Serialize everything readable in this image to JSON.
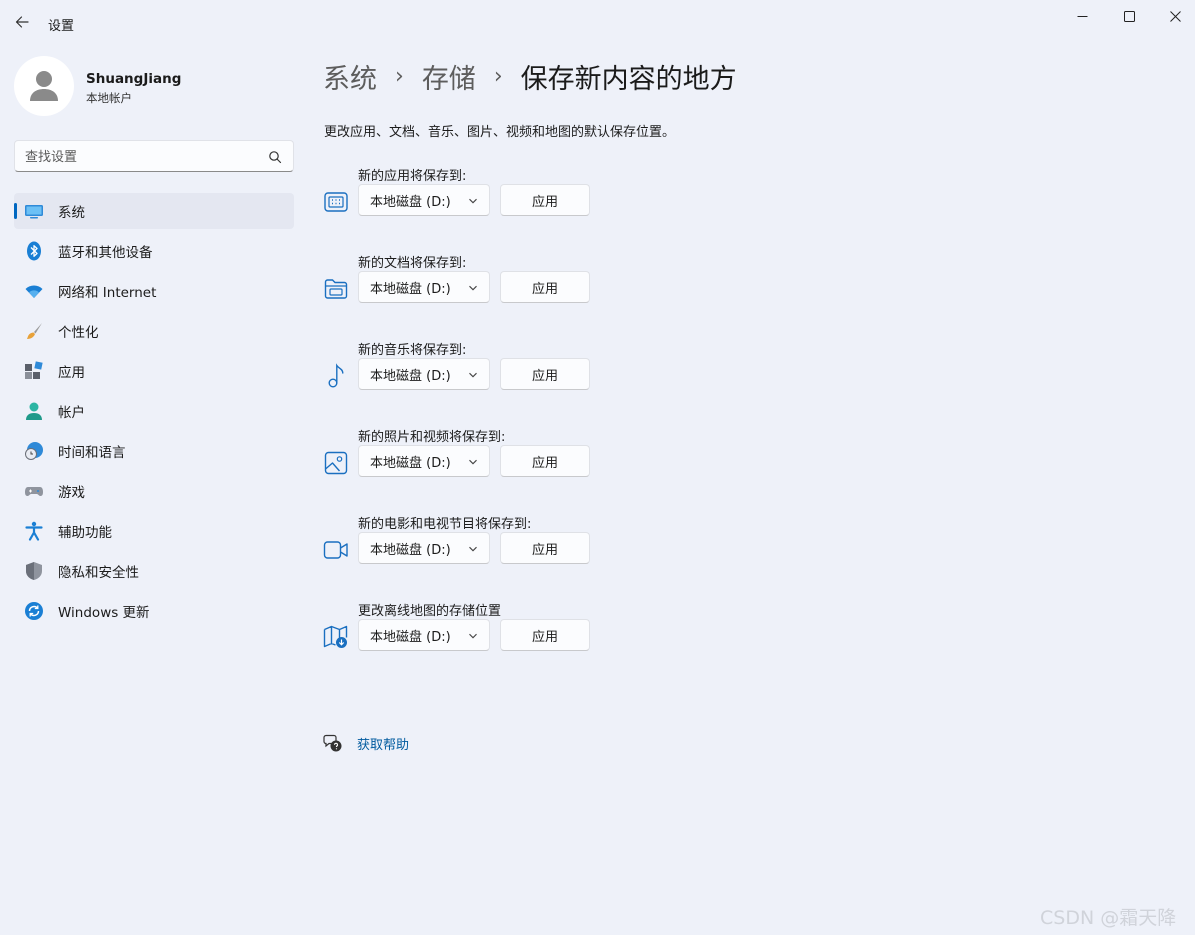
{
  "window": {
    "title": "设置",
    "back_icon": "back-arrow-icon",
    "controls": [
      "minimize-icon",
      "maximize-icon",
      "close-icon"
    ]
  },
  "profile": {
    "name": "ShuangJiang",
    "account_type": "本地帐户"
  },
  "search": {
    "placeholder": "查找设置"
  },
  "sidebar": {
    "active_index": 0,
    "items": [
      {
        "label": "系统",
        "icon": "system-display-icon"
      },
      {
        "label": "蓝牙和其他设备",
        "icon": "bluetooth-icon"
      },
      {
        "label": "网络和 Internet",
        "icon": "wifi-icon"
      },
      {
        "label": "个性化",
        "icon": "paintbrush-icon"
      },
      {
        "label": "应用",
        "icon": "apps-icon"
      },
      {
        "label": "帐户",
        "icon": "account-icon"
      },
      {
        "label": "时间和语言",
        "icon": "globe-clock-icon"
      },
      {
        "label": "游戏",
        "icon": "gamepad-icon"
      },
      {
        "label": "辅助功能",
        "icon": "accessibility-icon"
      },
      {
        "label": "隐私和安全性",
        "icon": "shield-icon"
      },
      {
        "label": "Windows 更新",
        "icon": "update-icon"
      }
    ]
  },
  "breadcrumb": {
    "items": [
      "系统",
      "存储",
      "保存新内容的地方"
    ],
    "separator": "›"
  },
  "main": {
    "description": "更改应用、文档、音乐、图片、视频和地图的默认保存位置。",
    "settings": [
      {
        "label": "新的应用将保存到:",
        "icon": "app-icon",
        "value": "本地磁盘 (D:)",
        "button": "应用"
      },
      {
        "label": "新的文档将保存到:",
        "icon": "folder-icon",
        "value": "本地磁盘 (D:)",
        "button": "应用"
      },
      {
        "label": "新的音乐将保存到:",
        "icon": "music-note-icon",
        "value": "本地磁盘 (D:)",
        "button": "应用"
      },
      {
        "label": "新的照片和视频将保存到:",
        "icon": "photo-icon",
        "value": "本地磁盘 (D:)",
        "button": "应用"
      },
      {
        "label": "新的电影和电视节目将保存到:",
        "icon": "video-camera-icon",
        "value": "本地磁盘 (D:)",
        "button": "应用"
      },
      {
        "label": "更改离线地图的存储位置",
        "icon": "map-download-icon",
        "value": "本地磁盘 (D:)",
        "button": "应用"
      }
    ],
    "help": {
      "label": "获取帮助",
      "icon": "help-chat-icon"
    }
  },
  "watermark": "CSDN @霜天降",
  "colors": {
    "background": "#eef1f9",
    "accent": "#0067c0",
    "link": "#005a9e"
  }
}
